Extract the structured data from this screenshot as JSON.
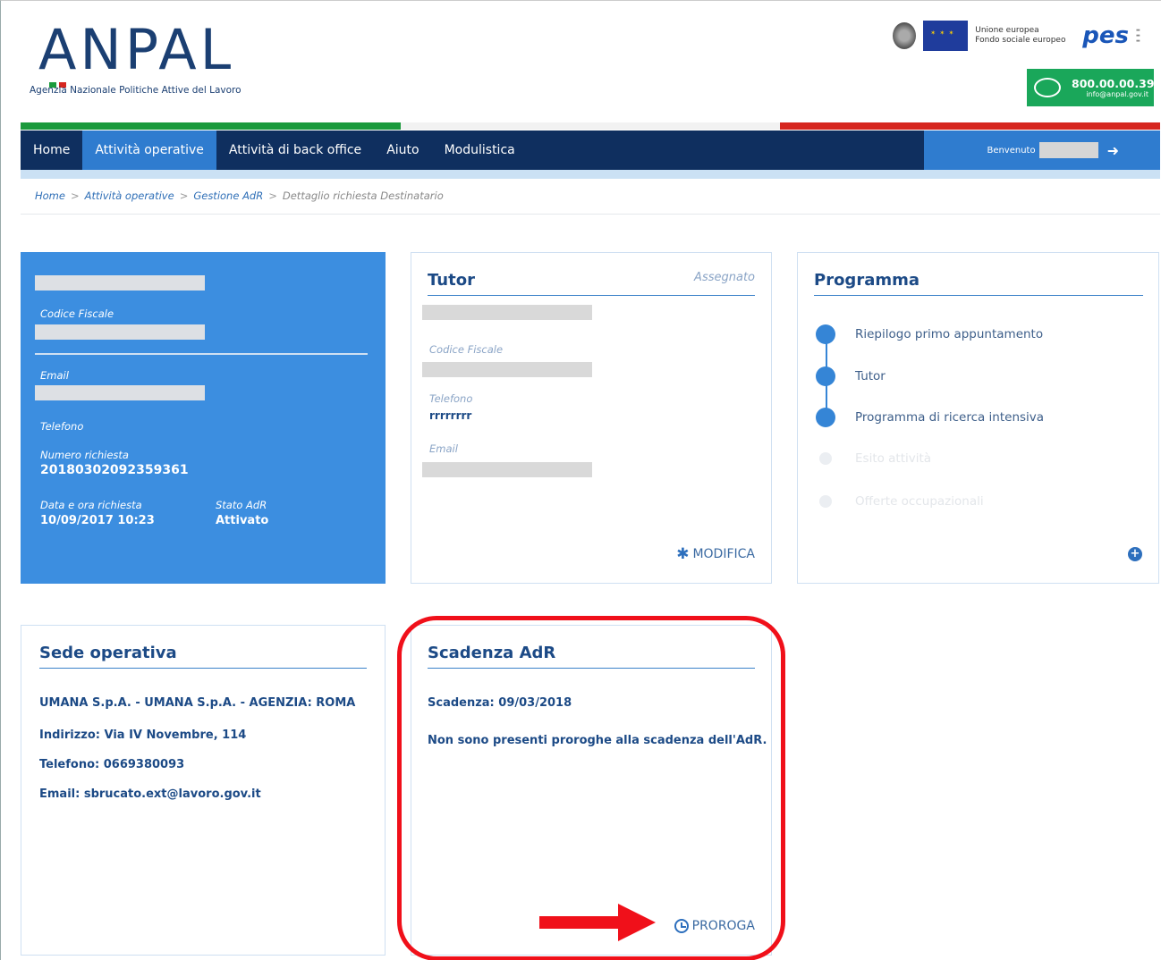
{
  "brand": {
    "logo_text": "ANPAL",
    "logo_subtitle": "Agenzia Nazionale Politiche Attive del Lavoro",
    "eu_text_line1": "Unione europea",
    "eu_text_line2": "Fondo sociale europeo",
    "pes_text": "pes",
    "contact_phone": "800.00.00.39",
    "contact_email": "info@anpal.gov.it",
    "colors": {
      "green": "#1aa75a",
      "navy": "#0f2f5f",
      "accent_blue": "#2f7ccf",
      "flag_green": "#1b9a3c",
      "flag_red": "#d6261f"
    }
  },
  "nav": {
    "items": [
      {
        "label": "Home",
        "active": false
      },
      {
        "label": "Attività operative",
        "active": true
      },
      {
        "label": "Attività di back office",
        "active": false
      },
      {
        "label": "Aiuto",
        "active": false
      },
      {
        "label": "Modulistica",
        "active": false
      }
    ],
    "welcome": "Benvenuto"
  },
  "breadcrumb": [
    "Home",
    "Attività operative",
    "Gestione AdR",
    "Dettaglio richiesta Destinatario"
  ],
  "user_card": {
    "codice_fiscale_label": "Codice Fiscale",
    "email_label": "Email",
    "telefono_label": "Telefono",
    "numero_label": "Numero richiesta",
    "numero_value": "20180302092359361",
    "data_label": "Data e ora richiesta",
    "data_value": "10/09/2017 10:23",
    "stato_label": "Stato AdR",
    "stato_value": "Attivato"
  },
  "tutor_card": {
    "title": "Tutor",
    "status": "Assegnato",
    "codice_fiscale_label": "Codice Fiscale",
    "telefono_label": "Telefono",
    "telefono_value": "rrrrrrrr",
    "email_label": "Email",
    "action": "MODIFICA"
  },
  "programma_card": {
    "title": "Programma",
    "steps": [
      {
        "label": "Riepilogo primo appuntamento",
        "done": true
      },
      {
        "label": "Tutor",
        "done": true
      },
      {
        "label": "Programma di ricerca intensiva",
        "done": true
      },
      {
        "label": "Esito attività",
        "done": false
      },
      {
        "label": "Offerte occupazionali",
        "done": false
      }
    ]
  },
  "sede_card": {
    "title": "Sede operativa",
    "lines": [
      "UMANA S.p.A. - UMANA S.p.A. - AGENZIA: ROMA",
      "Indirizzo: Via IV Novembre, 114",
      "Telefono: 0669380093",
      "Email: sbrucato.ext@lavoro.gov.it"
    ]
  },
  "scadenza_card": {
    "title": "Scadenza AdR",
    "scadenza": "Scadenza: 09/03/2018",
    "note": "Non sono presenti proroghe alla scadenza dell'AdR.",
    "action": "PROROGA"
  }
}
